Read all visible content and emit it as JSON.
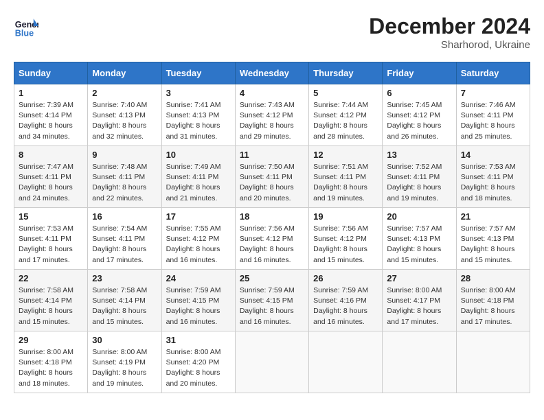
{
  "header": {
    "logo_line1": "General",
    "logo_line2": "Blue",
    "month_year": "December 2024",
    "location": "Sharhorod, Ukraine"
  },
  "weekdays": [
    "Sunday",
    "Monday",
    "Tuesday",
    "Wednesday",
    "Thursday",
    "Friday",
    "Saturday"
  ],
  "weeks": [
    [
      {
        "day": "1",
        "sunrise": "7:39 AM",
        "sunset": "4:14 PM",
        "daylight": "8 hours and 34 minutes."
      },
      {
        "day": "2",
        "sunrise": "7:40 AM",
        "sunset": "4:13 PM",
        "daylight": "8 hours and 32 minutes."
      },
      {
        "day": "3",
        "sunrise": "7:41 AM",
        "sunset": "4:13 PM",
        "daylight": "8 hours and 31 minutes."
      },
      {
        "day": "4",
        "sunrise": "7:43 AM",
        "sunset": "4:12 PM",
        "daylight": "8 hours and 29 minutes."
      },
      {
        "day": "5",
        "sunrise": "7:44 AM",
        "sunset": "4:12 PM",
        "daylight": "8 hours and 28 minutes."
      },
      {
        "day": "6",
        "sunrise": "7:45 AM",
        "sunset": "4:12 PM",
        "daylight": "8 hours and 26 minutes."
      },
      {
        "day": "7",
        "sunrise": "7:46 AM",
        "sunset": "4:11 PM",
        "daylight": "8 hours and 25 minutes."
      }
    ],
    [
      {
        "day": "8",
        "sunrise": "7:47 AM",
        "sunset": "4:11 PM",
        "daylight": "8 hours and 24 minutes."
      },
      {
        "day": "9",
        "sunrise": "7:48 AM",
        "sunset": "4:11 PM",
        "daylight": "8 hours and 22 minutes."
      },
      {
        "day": "10",
        "sunrise": "7:49 AM",
        "sunset": "4:11 PM",
        "daylight": "8 hours and 21 minutes."
      },
      {
        "day": "11",
        "sunrise": "7:50 AM",
        "sunset": "4:11 PM",
        "daylight": "8 hours and 20 minutes."
      },
      {
        "day": "12",
        "sunrise": "7:51 AM",
        "sunset": "4:11 PM",
        "daylight": "8 hours and 19 minutes."
      },
      {
        "day": "13",
        "sunrise": "7:52 AM",
        "sunset": "4:11 PM",
        "daylight": "8 hours and 19 minutes."
      },
      {
        "day": "14",
        "sunrise": "7:53 AM",
        "sunset": "4:11 PM",
        "daylight": "8 hours and 18 minutes."
      }
    ],
    [
      {
        "day": "15",
        "sunrise": "7:53 AM",
        "sunset": "4:11 PM",
        "daylight": "8 hours and 17 minutes."
      },
      {
        "day": "16",
        "sunrise": "7:54 AM",
        "sunset": "4:11 PM",
        "daylight": "8 hours and 17 minutes."
      },
      {
        "day": "17",
        "sunrise": "7:55 AM",
        "sunset": "4:12 PM",
        "daylight": "8 hours and 16 minutes."
      },
      {
        "day": "18",
        "sunrise": "7:56 AM",
        "sunset": "4:12 PM",
        "daylight": "8 hours and 16 minutes."
      },
      {
        "day": "19",
        "sunrise": "7:56 AM",
        "sunset": "4:12 PM",
        "daylight": "8 hours and 15 minutes."
      },
      {
        "day": "20",
        "sunrise": "7:57 AM",
        "sunset": "4:13 PM",
        "daylight": "8 hours and 15 minutes."
      },
      {
        "day": "21",
        "sunrise": "7:57 AM",
        "sunset": "4:13 PM",
        "daylight": "8 hours and 15 minutes."
      }
    ],
    [
      {
        "day": "22",
        "sunrise": "7:58 AM",
        "sunset": "4:14 PM",
        "daylight": "8 hours and 15 minutes."
      },
      {
        "day": "23",
        "sunrise": "7:58 AM",
        "sunset": "4:14 PM",
        "daylight": "8 hours and 15 minutes."
      },
      {
        "day": "24",
        "sunrise": "7:59 AM",
        "sunset": "4:15 PM",
        "daylight": "8 hours and 16 minutes."
      },
      {
        "day": "25",
        "sunrise": "7:59 AM",
        "sunset": "4:15 PM",
        "daylight": "8 hours and 16 minutes."
      },
      {
        "day": "26",
        "sunrise": "7:59 AM",
        "sunset": "4:16 PM",
        "daylight": "8 hours and 16 minutes."
      },
      {
        "day": "27",
        "sunrise": "8:00 AM",
        "sunset": "4:17 PM",
        "daylight": "8 hours and 17 minutes."
      },
      {
        "day": "28",
        "sunrise": "8:00 AM",
        "sunset": "4:18 PM",
        "daylight": "8 hours and 17 minutes."
      }
    ],
    [
      {
        "day": "29",
        "sunrise": "8:00 AM",
        "sunset": "4:18 PM",
        "daylight": "8 hours and 18 minutes."
      },
      {
        "day": "30",
        "sunrise": "8:00 AM",
        "sunset": "4:19 PM",
        "daylight": "8 hours and 19 minutes."
      },
      {
        "day": "31",
        "sunrise": "8:00 AM",
        "sunset": "4:20 PM",
        "daylight": "8 hours and 20 minutes."
      },
      null,
      null,
      null,
      null
    ]
  ]
}
